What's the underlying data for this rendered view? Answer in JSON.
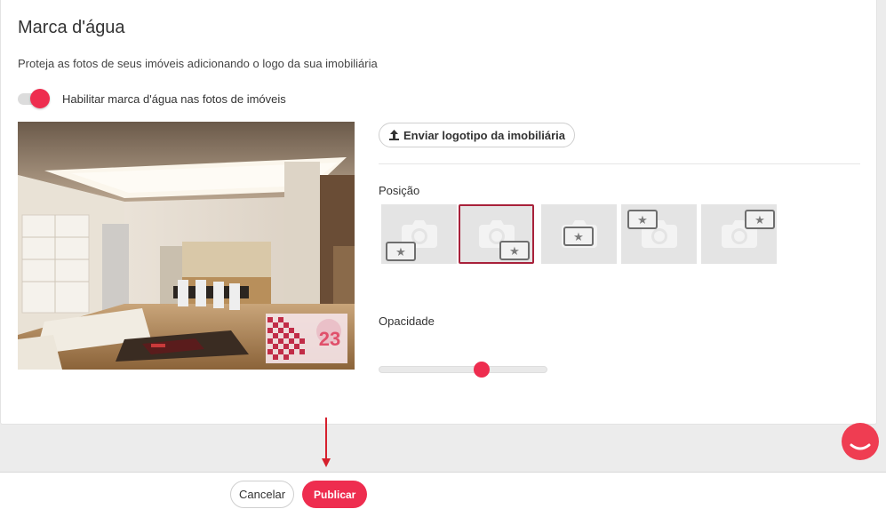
{
  "section": {
    "title": "Marca d'água",
    "description": "Proteja as fotos de seus imóveis adicionando o logo da sua imobiliária",
    "toggle_label": "Habilitar marca d'água nas fotos de imóveis",
    "toggle_on": true
  },
  "preview": {
    "watermark_text": "23"
  },
  "upload": {
    "label": "Enviar logotipo da imobiliária",
    "icon": "upload-icon"
  },
  "position": {
    "label": "Posição",
    "selected_index": 1,
    "options": [
      {
        "name": "bottom-left"
      },
      {
        "name": "bottom-right"
      },
      {
        "name": "center"
      },
      {
        "name": "top-left"
      },
      {
        "name": "top-right"
      }
    ]
  },
  "opacity": {
    "label": "Opacidade",
    "value_fraction": 0.62
  },
  "footer": {
    "cancel_label": "Cancelar",
    "publish_label": "Publicar"
  },
  "colors": {
    "accent": "#ee2d4f",
    "selected_border": "#a8213a"
  }
}
